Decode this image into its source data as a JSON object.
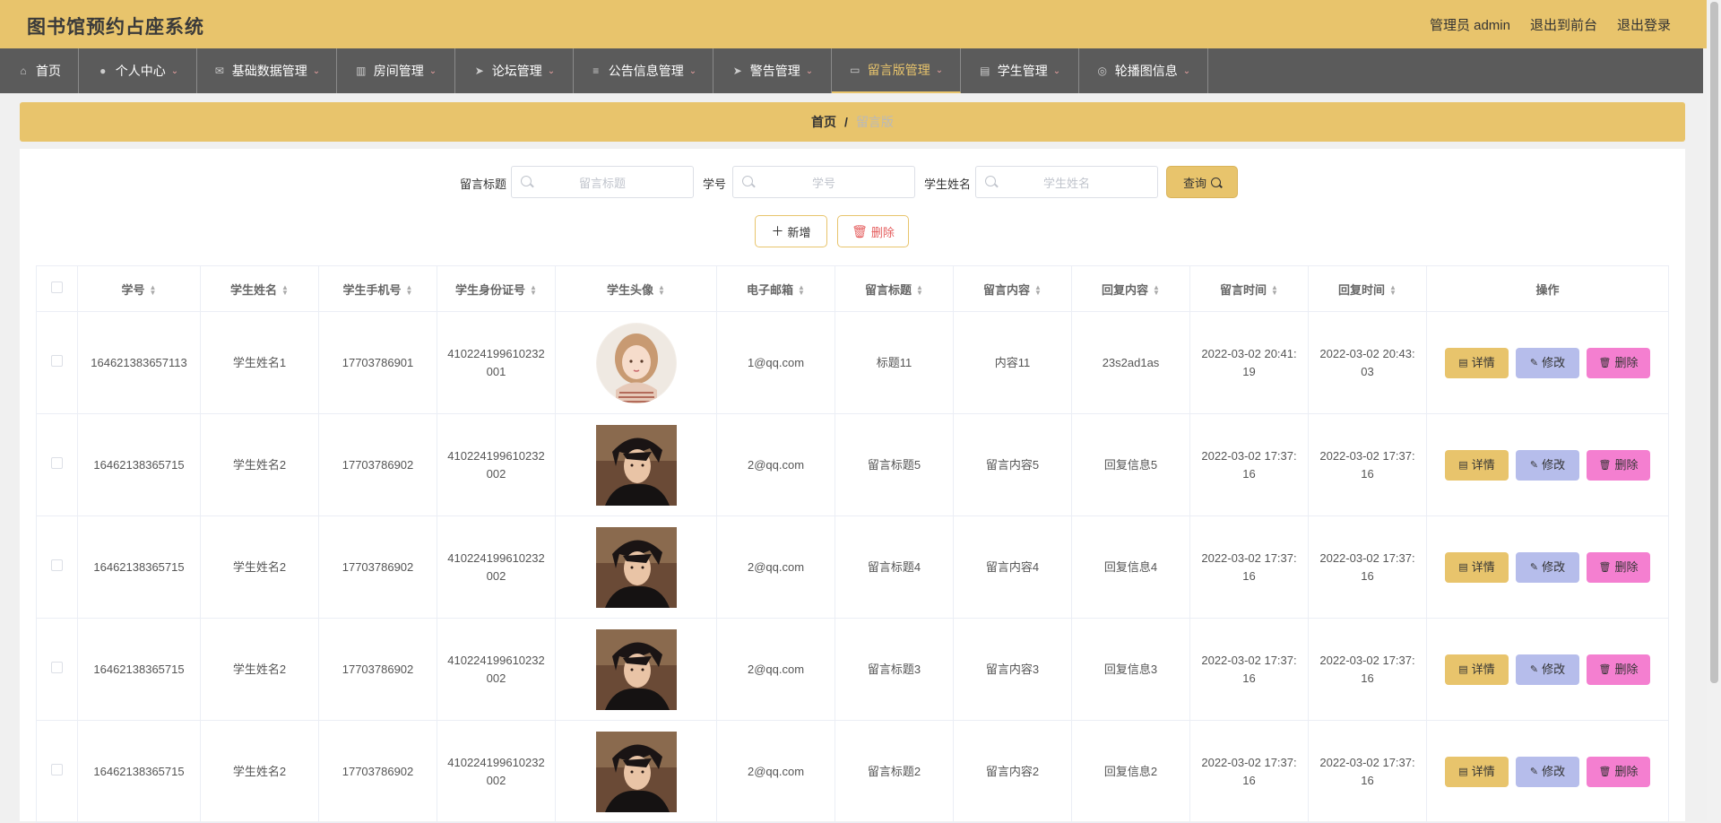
{
  "header": {
    "title": "图书馆预约占座系统",
    "user_label": "管理员 admin",
    "front_link": "退出到前台",
    "logout_link": "退出登录"
  },
  "nav": {
    "items": [
      {
        "label": "首页",
        "icon": "home-icon",
        "dropdown": false
      },
      {
        "label": "个人中心",
        "icon": "user-icon",
        "dropdown": true
      },
      {
        "label": "基础数据管理",
        "icon": "mail-icon",
        "dropdown": true
      },
      {
        "label": "房间管理",
        "icon": "chart-icon",
        "dropdown": true
      },
      {
        "label": "论坛管理",
        "icon": "send-icon",
        "dropdown": true
      },
      {
        "label": "公告信息管理",
        "icon": "list-icon",
        "dropdown": true
      },
      {
        "label": "警告管理",
        "icon": "send-icon",
        "dropdown": true
      },
      {
        "label": "留言版管理",
        "icon": "briefcase-icon",
        "dropdown": true,
        "active": true
      },
      {
        "label": "学生管理",
        "icon": "clipboard-icon",
        "dropdown": true
      },
      {
        "label": "轮播图信息",
        "icon": "compass-icon",
        "dropdown": true
      }
    ]
  },
  "breadcrumb": {
    "home": "首页",
    "separator": "/",
    "current": "留言版"
  },
  "search": {
    "title_label": "留言标题",
    "title_placeholder": "留言标题",
    "student_no_label": "学号",
    "student_no_placeholder": "学号",
    "student_name_label": "学生姓名",
    "student_name_placeholder": "学生姓名",
    "query_button": "查询"
  },
  "actions": {
    "add_button": "新增",
    "delete_button": "删除"
  },
  "table": {
    "columns": [
      "学号",
      "学生姓名",
      "学生手机号",
      "学生身份证号",
      "学生头像",
      "电子邮箱",
      "留言标题",
      "留言内容",
      "回复内容",
      "留言时间",
      "回复时间",
      "操作"
    ],
    "rows": [
      {
        "student_no": "164621383657113",
        "name": "学生姓名1",
        "phone": "17703786901",
        "id_card": "410224199610232001",
        "avatar": "girl-avatar",
        "email": "1@qq.com",
        "title": "标题11",
        "content": "内容11",
        "reply": "23s2ad1as",
        "msg_time": "2022-03-02 20:41:19",
        "reply_time": "2022-03-02 20:43:03"
      },
      {
        "student_no": "16462138365715",
        "name": "学生姓名2",
        "phone": "17703786902",
        "id_card": "410224199610232002",
        "avatar": "boy-avatar",
        "email": "2@qq.com",
        "title": "留言标题5",
        "content": "留言内容5",
        "reply": "回复信息5",
        "msg_time": "2022-03-02 17:37:16",
        "reply_time": "2022-03-02 17:37:16"
      },
      {
        "student_no": "16462138365715",
        "name": "学生姓名2",
        "phone": "17703786902",
        "id_card": "410224199610232002",
        "avatar": "boy-avatar",
        "email": "2@qq.com",
        "title": "留言标题4",
        "content": "留言内容4",
        "reply": "回复信息4",
        "msg_time": "2022-03-02 17:37:16",
        "reply_time": "2022-03-02 17:37:16"
      },
      {
        "student_no": "16462138365715",
        "name": "学生姓名2",
        "phone": "17703786902",
        "id_card": "410224199610232002",
        "avatar": "boy-avatar",
        "email": "2@qq.com",
        "title": "留言标题3",
        "content": "留言内容3",
        "reply": "回复信息3",
        "msg_time": "2022-03-02 17:37:16",
        "reply_time": "2022-03-02 17:37:16"
      },
      {
        "student_no": "16462138365715",
        "name": "学生姓名2",
        "phone": "17703786902",
        "id_card": "410224199610232002",
        "avatar": "boy-avatar",
        "email": "2@qq.com",
        "title": "留言标题2",
        "content": "留言内容2",
        "reply": "回复信息2",
        "msg_time": "2022-03-02 17:37:16",
        "reply_time": "2022-03-02 17:37:16"
      }
    ],
    "row_actions": {
      "detail": "详情",
      "edit": "修改",
      "delete": "删除"
    }
  },
  "colors": {
    "accent": "#e8c46c",
    "nav_bg": "#5b5b5b",
    "edit_btn": "#b6bdeb",
    "delete_btn": "#f47fd0"
  }
}
